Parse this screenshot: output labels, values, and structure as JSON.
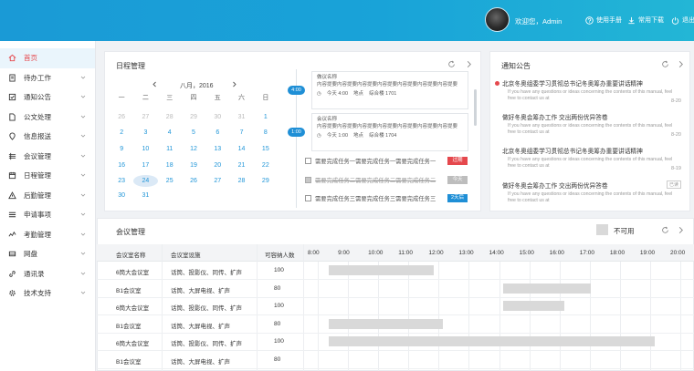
{
  "header": {
    "welcome": "欢迎您，Admin",
    "manual": "使用手册",
    "downloads": "常用下载",
    "logout": "退出",
    "accent": "#1a9ad6"
  },
  "sidebar": {
    "items": [
      {
        "label": "首页",
        "icon": "home-icon",
        "active": true
      },
      {
        "label": "待办工作",
        "icon": "todo-icon"
      },
      {
        "label": "通知公告",
        "icon": "notice-icon"
      },
      {
        "label": "公文处理",
        "icon": "document-icon"
      },
      {
        "label": "信息报送",
        "icon": "location-icon"
      },
      {
        "label": "会议管理",
        "icon": "meeting-icon"
      },
      {
        "label": "日程管理",
        "icon": "schedule-icon"
      },
      {
        "label": "后勤管理",
        "icon": "warning-icon"
      },
      {
        "label": "申请事项",
        "icon": "apply-icon"
      },
      {
        "label": "考勤管理",
        "icon": "attendance-icon"
      },
      {
        "label": "网盘",
        "icon": "disk-icon"
      },
      {
        "label": "通讯录",
        "icon": "link-icon"
      },
      {
        "label": "技术支持",
        "icon": "gear-icon"
      }
    ]
  },
  "schedule": {
    "title": "日程管理",
    "month": "八月，2016",
    "weekdays": [
      "一",
      "二",
      "三",
      "四",
      "五",
      "六",
      "日"
    ],
    "weeks": [
      [
        "26",
        "27",
        "28",
        "29",
        "30",
        "31",
        "1"
      ],
      [
        "2",
        "3",
        "4",
        "5",
        "6",
        "7",
        "8"
      ],
      [
        "9",
        "10",
        "11",
        "12",
        "13",
        "14",
        "15"
      ],
      [
        "16",
        "17",
        "18",
        "19",
        "20",
        "21",
        "22"
      ],
      [
        "23",
        "24",
        "25",
        "26",
        "27",
        "28",
        "29"
      ],
      [
        "30",
        "31",
        "",
        "",
        "",
        "",
        ""
      ]
    ],
    "today": "24",
    "events": [
      {
        "time": "4:00",
        "title": "做议名称",
        "content": "内容提要内容提要内容提要内容提要内容提要内容提要内容提要",
        "when": "今天 4:00",
        "place_label": "地点",
        "place": "综合楼 1701"
      },
      {
        "time": "1:00",
        "title": "会议名称",
        "content": "内容提要内容提要内容提要内容提要内容提要内容提要内容提要",
        "when": "今天 1:00",
        "place_label": "地点",
        "place": "综合楼 1704"
      }
    ],
    "tasks": [
      {
        "text": "需要完成任务一需要完成任务一需要完成任务一",
        "badge": "过期",
        "badge_color": "#e5484d",
        "done": false
      },
      {
        "text": "需要完成任务二需要完成任务二需要完成任务二",
        "badge": "今天",
        "badge_color": "#bdbdbd",
        "done": true
      },
      {
        "text": "需要完成任务三需要完成任务三需要完成任务三",
        "badge": "2天后",
        "badge_color": "#1f8fd6",
        "done": false
      }
    ]
  },
  "notices": {
    "title": "通知公告",
    "items": [
      {
        "title": "北京冬奥组委学习贯彻总书记冬奥筹办重要讲话精神",
        "desc": "If you have any questions or ideas concerning the contents of this manual, feel free to contact us at",
        "date": "8-20",
        "unread": true
      },
      {
        "title": "做好冬奥会筹办工作 交出两份优异答卷",
        "desc": "If you have any questions or ideas concerning the contents of this manual, feel free to contact us at",
        "date": "8-20",
        "unread": false
      },
      {
        "title": "北京冬奥组委学习贯彻总书记冬奥筹办重要讲话精神",
        "desc": "If you have any questions or ideas concerning the contents of this manual, feel free to contact us at",
        "date": "8-19",
        "unread": false
      },
      {
        "title": "做好冬奥会筹办工作 交出两份优异答卷",
        "desc": "If you have any questions or ideas concerning the contents of this manual, feel free to contact us at",
        "date": "8-19",
        "tag": "已读",
        "unread": false
      }
    ]
  },
  "meetings": {
    "title": "会议管理",
    "legend_unavailable": "不可用",
    "columns": [
      "会议室名称",
      "会议室设施",
      "可容纳人数"
    ],
    "times": [
      "8:00",
      "9:00",
      "10:00",
      "11:00",
      "12:00",
      "13:00",
      "14:00",
      "15:00",
      "16:00",
      "17:00",
      "18:00",
      "19:00",
      "20:00"
    ],
    "rows": [
      {
        "name": "6筒大会议室",
        "facility": "话筒、投影仪、同传、扩声",
        "capacity": "100",
        "busy": [
          [
            8.5,
            12.0
          ]
        ]
      },
      {
        "name": "B1会议室",
        "facility": "话筒、大屏电视、扩声",
        "capacity": "80",
        "busy": [
          [
            14.3,
            17.2
          ]
        ]
      },
      {
        "name": "6筒大会议室",
        "facility": "话筒、投影仪、同传、扩声",
        "capacity": "100",
        "busy": [
          [
            14.3,
            16.3
          ]
        ]
      },
      {
        "name": "B1会议室",
        "facility": "话筒、大屏电视、扩声",
        "capacity": "80",
        "busy": [
          [
            8.5,
            12.3
          ]
        ]
      },
      {
        "name": "6筒大会议室",
        "facility": "话筒、投影仪、同传、扩声",
        "capacity": "100",
        "busy": [
          [
            8.5,
            19.3
          ]
        ]
      },
      {
        "name": "B1会议室",
        "facility": "话筒、大屏电视、扩声",
        "capacity": "80",
        "busy": []
      }
    ]
  }
}
